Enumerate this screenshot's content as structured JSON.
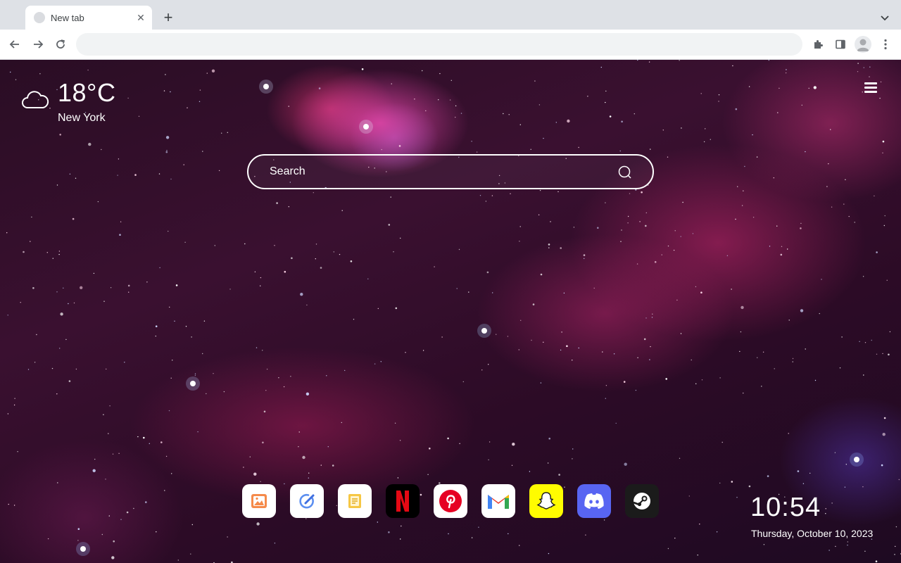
{
  "browser": {
    "tab": {
      "title": "New tab"
    },
    "omnibox": {
      "value": "",
      "placeholder": ""
    }
  },
  "weather": {
    "temperature": "18°C",
    "city": "New York",
    "icon": "cloud-icon"
  },
  "search": {
    "placeholder": "Search"
  },
  "dock": {
    "items": [
      {
        "name": "photos",
        "icon": "image-icon",
        "bg": "#ffffff"
      },
      {
        "name": "edit",
        "icon": "pencil-check-icon",
        "bg": "#ffffff"
      },
      {
        "name": "notes",
        "icon": "notes-icon",
        "bg": "#ffffff"
      },
      {
        "name": "netflix",
        "icon": "netflix-icon",
        "bg": "#000000"
      },
      {
        "name": "pinterest",
        "icon": "pinterest-icon",
        "bg": "#ffffff"
      },
      {
        "name": "gmail",
        "icon": "gmail-icon",
        "bg": "#ffffff"
      },
      {
        "name": "snapchat",
        "icon": "snapchat-icon",
        "bg": "#fffc00"
      },
      {
        "name": "discord",
        "icon": "discord-icon",
        "bg": "#5865f2"
      },
      {
        "name": "steam",
        "icon": "steam-icon",
        "bg": "#1b1b1b"
      }
    ]
  },
  "clock": {
    "time": "10:54",
    "date": "Thursday, October 10, 2023"
  },
  "colors": {
    "accent_text": "#ffffff",
    "netflix_red": "#e50914",
    "pinterest_red": "#e60023",
    "discord_blurple": "#5865f2",
    "snapchat_yellow": "#fffc00"
  }
}
